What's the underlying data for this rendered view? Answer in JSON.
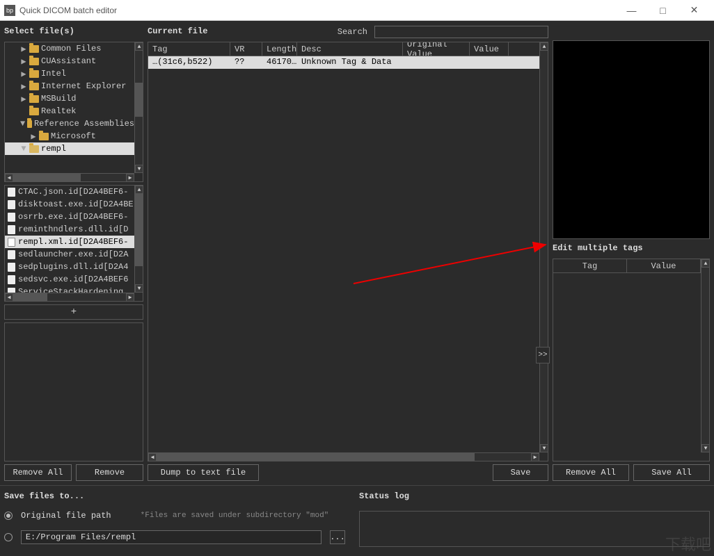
{
  "window": {
    "app_icon_text": "bp",
    "title": "Quick DICOM batch editor"
  },
  "labels": {
    "select_files": "Select file(s)",
    "current_file": "Current file",
    "search": "Search",
    "edit_multiple": "Edit multiple tags",
    "save_files_to": "Save files to...",
    "status_log": "Status log",
    "original_path": "Original file path",
    "hint": "*Files are saved under subdirectory \"mod\""
  },
  "tree": [
    {
      "indent": 1,
      "arrow": "▶",
      "label": "Common Files"
    },
    {
      "indent": 1,
      "arrow": "▶",
      "label": "CUAssistant"
    },
    {
      "indent": 1,
      "arrow": "▶",
      "label": "Intel"
    },
    {
      "indent": 1,
      "arrow": "▶",
      "label": "Internet Explorer"
    },
    {
      "indent": 1,
      "arrow": "▶",
      "label": "MSBuild"
    },
    {
      "indent": 1,
      "arrow": "",
      "label": "Realtek"
    },
    {
      "indent": 1,
      "arrow": "▼",
      "label": "Reference Assemblies"
    },
    {
      "indent": 2,
      "arrow": "▶",
      "label": "Microsoft"
    },
    {
      "indent": 1,
      "arrow": "▼",
      "label": "rempl",
      "selected": true,
      "open": true
    }
  ],
  "files": [
    "CTAC.json.id[D2A4BEF6-",
    "disktoast.exe.id[D2A4BE",
    "osrrb.exe.id[D2A4BEF6-",
    "reminthndlers.dll.id[D",
    "rempl.xml.id[D2A4BEF6-",
    "sedlauncher.exe.id[D2A",
    "sedplugins.dll.id[D2A4",
    "sedsvc.exe.id[D2A4BEF6",
    "ServiceStackHardening."
  ],
  "files_selected_index": 4,
  "table": {
    "headers": [
      "Tag",
      "VR",
      "Length",
      "Desc",
      "Original Value",
      "Value"
    ],
    "widths": [
      118,
      46,
      50,
      152,
      96,
      56
    ],
    "rows": [
      {
        "cells": [
          "…(31c6,b522)",
          "??",
          "46170…",
          "Unknown Tag & Data",
          "",
          ""
        ],
        "selected": true
      }
    ]
  },
  "edit_table": {
    "headers": [
      "Tag",
      "Value"
    ]
  },
  "buttons": {
    "add": "+",
    "remove_all": "Remove All",
    "remove": "Remove",
    "dump": "Dump to text file",
    "save": "Save",
    "save_all": "Save All",
    "expand": ">>",
    "browse": "..."
  },
  "save_path": "E:/Program Files/rempl",
  "watermark": "下载吧"
}
